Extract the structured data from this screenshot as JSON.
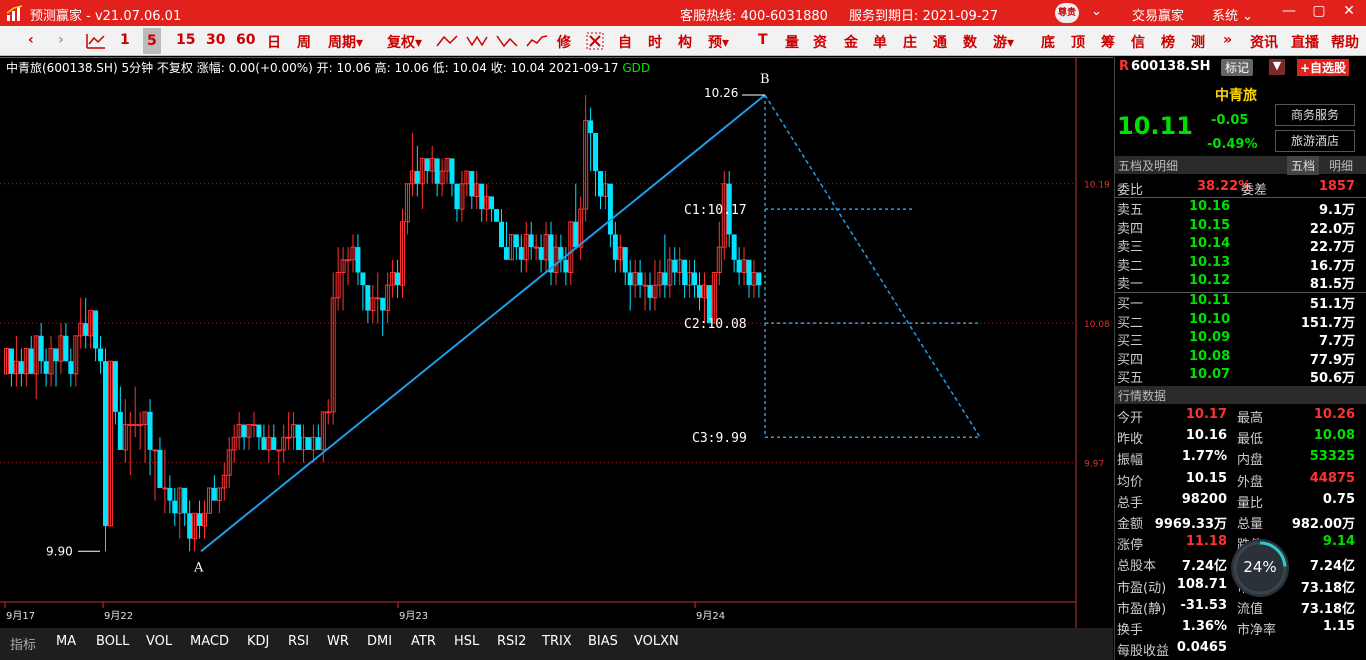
{
  "titlebar": {
    "app_title": "预测赢家 - v21.07.06.01",
    "hotline": "客服热线: 400-6031880",
    "expiry": "服务到期日: 2021-09-27",
    "avatar_text": "尊贵",
    "menu_trade": "交易赢家",
    "menu_system": "系统",
    "minimize": "—",
    "restore": "▢",
    "close": "✕"
  },
  "toolbar": {
    "periods": [
      "1",
      "5",
      "15",
      "30",
      "60",
      "日",
      "周"
    ],
    "selected_period": "5",
    "period_menu": "周期",
    "fq": "复权",
    "xiu": "修",
    "items": [
      "自",
      "时",
      "构",
      "预"
    ],
    "items2": [
      "T",
      "量",
      "资",
      "金",
      "单",
      "庄",
      "通",
      "数",
      "游"
    ],
    "items3": [
      "底",
      "顶",
      "筹",
      "信",
      "榜",
      "测"
    ],
    "more": "»",
    "news": "资讯",
    "live": "直播",
    "help": "帮助"
  },
  "chart": {
    "info": "中青旅(600138.SH) 5分钟 不复权 涨幅: 0.00(+0.00%) 开: 10.06 高: 10.06 低: 10.04 收: 10.04 2021-09-17",
    "indicator_name": "GDD",
    "annotations": {
      "b_price": "10.26",
      "b_label": "B",
      "a_price": "9.90",
      "a_label": "A",
      "c1": "C1:10.17",
      "c2": "C2:10.08",
      "c3": "C3:9.99"
    },
    "right_axis": [
      "10.19",
      "10.08",
      "9.97"
    ],
    "x_labels": [
      "9月17",
      "9月22",
      "9月23",
      "9月24"
    ]
  },
  "chart_data": {
    "type": "candlestick",
    "ylim": [
      9.86,
      10.29
    ],
    "right_axis_ticks": [
      10.19,
      10.08,
      9.97
    ],
    "pattern": {
      "A": 9.9,
      "B": 10.26,
      "C1": 10.17,
      "C2": 10.08,
      "C3": 9.99
    },
    "candles": [
      [
        10.04,
        10.06,
        10.04,
        10.06
      ],
      [
        10.06,
        10.04,
        10.03,
        10.06
      ],
      [
        10.04,
        10.05,
        10.03,
        10.07
      ],
      [
        10.05,
        10.04,
        10.03,
        10.06
      ],
      [
        10.04,
        10.06,
        10.03,
        10.06
      ],
      [
        10.06,
        10.04,
        10.04,
        10.07
      ],
      [
        10.04,
        10.07,
        10.02,
        10.07
      ],
      [
        10.07,
        10.05,
        10.04,
        10.08
      ],
      [
        10.05,
        10.04,
        10.03,
        10.06
      ],
      [
        10.04,
        10.06,
        10.03,
        10.07
      ],
      [
        10.06,
        10.05,
        10.03,
        10.06
      ],
      [
        10.05,
        10.07,
        10.04,
        10.08
      ],
      [
        10.07,
        10.05,
        10.05,
        10.08
      ],
      [
        10.05,
        10.04,
        10.03,
        10.06
      ],
      [
        10.04,
        10.07,
        10.03,
        10.07
      ],
      [
        10.07,
        10.08,
        10.06,
        10.1
      ],
      [
        10.08,
        10.07,
        10.06,
        10.1
      ],
      [
        10.07,
        10.09,
        10.06,
        10.09
      ],
      [
        10.09,
        10.06,
        10.05,
        10.09
      ],
      [
        10.06,
        10.05,
        10.04,
        10.07
      ],
      [
        10.05,
        9.92,
        9.9,
        10.06
      ],
      [
        9.92,
        10.05,
        9.92,
        10.05
      ],
      [
        10.05,
        10.01,
        10.0,
        10.05
      ],
      [
        10.01,
        9.98,
        9.98,
        10.03
      ],
      [
        9.98,
        10.0,
        9.97,
        10.02
      ],
      [
        10.0,
        10.0,
        9.96,
        10.01
      ],
      [
        10.0,
        10.0,
        9.99,
        10.03
      ],
      [
        10.0,
        10.0,
        9.98,
        10.01
      ],
      [
        10.0,
        10.01,
        9.97,
        10.01
      ],
      [
        10.01,
        9.98,
        9.96,
        10.02
      ],
      [
        9.98,
        9.98,
        9.94,
        9.98
      ],
      [
        9.98,
        9.95,
        9.95,
        9.99
      ],
      [
        9.95,
        9.95,
        9.93,
        9.98
      ],
      [
        9.95,
        9.94,
        9.93,
        9.96
      ],
      [
        9.94,
        9.93,
        9.92,
        9.95
      ],
      [
        9.93,
        9.95,
        9.91,
        9.95
      ],
      [
        9.95,
        9.93,
        9.92,
        9.95
      ],
      [
        9.93,
        9.91,
        9.9,
        9.94
      ],
      [
        9.91,
        9.93,
        9.9,
        9.93
      ],
      [
        9.93,
        9.92,
        9.91,
        9.94
      ],
      [
        9.92,
        9.93,
        9.91,
        9.94
      ],
      [
        9.93,
        9.95,
        9.93,
        9.95
      ],
      [
        9.95,
        9.94,
        9.94,
        9.96
      ],
      [
        9.94,
        9.95,
        9.93,
        9.95
      ],
      [
        9.95,
        9.96,
        9.94,
        9.97
      ],
      [
        9.96,
        9.98,
        9.95,
        9.99
      ],
      [
        9.98,
        9.99,
        9.97,
        10.0
      ],
      [
        9.99,
        10.0,
        9.98,
        10.01
      ],
      [
        10.0,
        9.99,
        9.98,
        10.0
      ],
      [
        9.99,
        10.0,
        9.98,
        10.0
      ],
      [
        10.0,
        10.0,
        9.99,
        10.01
      ],
      [
        10.0,
        9.99,
        9.98,
        10.0
      ],
      [
        9.99,
        9.98,
        9.98,
        10.0
      ],
      [
        9.98,
        9.99,
        9.97,
        10.0
      ],
      [
        9.99,
        9.98,
        9.98,
        10.0
      ],
      [
        9.98,
        9.98,
        9.96,
        9.98
      ],
      [
        9.98,
        9.99,
        9.97,
        10.0
      ],
      [
        9.99,
        9.99,
        9.98,
        10.01
      ],
      [
        9.99,
        10.0,
        9.98,
        10.01
      ],
      [
        10.0,
        9.98,
        9.98,
        10.0
      ],
      [
        9.98,
        9.99,
        9.97,
        10.0
      ],
      [
        9.99,
        9.98,
        9.98,
        9.99
      ],
      [
        9.98,
        9.99,
        9.97,
        10.0
      ],
      [
        9.99,
        9.98,
        9.98,
        10.0
      ],
      [
        9.98,
        10.01,
        9.97,
        10.01
      ],
      [
        10.01,
        10.01,
        10.0,
        10.02
      ],
      [
        10.01,
        10.1,
        10.0,
        10.12
      ],
      [
        10.1,
        10.12,
        10.09,
        10.14
      ],
      [
        10.12,
        10.13,
        10.09,
        10.14
      ],
      [
        10.13,
        10.13,
        10.11,
        10.14
      ],
      [
        10.13,
        10.14,
        10.12,
        10.15
      ],
      [
        10.14,
        10.12,
        10.11,
        10.15
      ],
      [
        10.12,
        10.11,
        10.09,
        10.12
      ],
      [
        10.11,
        10.09,
        10.08,
        10.11
      ],
      [
        10.09,
        10.1,
        10.08,
        10.11
      ],
      [
        10.1,
        10.1,
        10.08,
        10.12
      ],
      [
        10.1,
        10.09,
        10.07,
        10.1
      ],
      [
        10.09,
        10.11,
        10.08,
        10.12
      ],
      [
        10.11,
        10.12,
        10.1,
        10.13
      ],
      [
        10.12,
        10.11,
        10.1,
        10.13
      ],
      [
        10.11,
        10.16,
        10.1,
        10.17
      ],
      [
        10.16,
        10.19,
        10.15,
        10.19
      ],
      [
        10.19,
        10.2,
        10.18,
        10.23
      ],
      [
        10.2,
        10.19,
        10.18,
        10.22
      ],
      [
        10.19,
        10.21,
        10.17,
        10.21
      ],
      [
        10.21,
        10.2,
        10.19,
        10.21
      ],
      [
        10.2,
        10.21,
        10.19,
        10.22
      ],
      [
        10.21,
        10.19,
        10.18,
        10.21
      ],
      [
        10.19,
        10.2,
        10.18,
        10.21
      ],
      [
        10.2,
        10.21,
        10.19,
        10.21
      ],
      [
        10.21,
        10.19,
        10.18,
        10.21
      ],
      [
        10.19,
        10.17,
        10.16,
        10.19
      ],
      [
        10.17,
        10.19,
        10.16,
        10.2
      ],
      [
        10.19,
        10.2,
        10.18,
        10.2
      ],
      [
        10.2,
        10.18,
        10.17,
        10.2
      ],
      [
        10.18,
        10.19,
        10.17,
        10.2
      ],
      [
        10.19,
        10.17,
        10.16,
        10.19
      ],
      [
        10.17,
        10.18,
        10.16,
        10.19
      ],
      [
        10.18,
        10.17,
        10.16,
        10.18
      ],
      [
        10.17,
        10.16,
        10.16,
        10.17
      ],
      [
        10.16,
        10.14,
        10.14,
        10.17
      ],
      [
        10.14,
        10.13,
        10.13,
        10.16
      ],
      [
        10.13,
        10.15,
        10.13,
        10.15
      ],
      [
        10.15,
        10.14,
        10.13,
        10.15
      ],
      [
        10.14,
        10.13,
        10.12,
        10.15
      ],
      [
        10.13,
        10.15,
        10.12,
        10.16
      ],
      [
        10.15,
        10.14,
        10.13,
        10.16
      ],
      [
        10.14,
        10.14,
        10.13,
        10.15
      ],
      [
        10.14,
        10.13,
        10.12,
        10.15
      ],
      [
        10.13,
        10.15,
        10.12,
        10.16
      ],
      [
        10.15,
        10.12,
        10.11,
        10.16
      ],
      [
        10.12,
        10.14,
        10.11,
        10.15
      ],
      [
        10.14,
        10.13,
        10.12,
        10.15
      ],
      [
        10.13,
        10.12,
        10.11,
        10.14
      ],
      [
        10.12,
        10.16,
        10.11,
        10.16
      ],
      [
        10.16,
        10.14,
        10.14,
        10.19
      ],
      [
        10.14,
        10.17,
        10.13,
        10.18
      ],
      [
        10.17,
        10.24,
        10.16,
        10.26
      ],
      [
        10.24,
        10.23,
        10.2,
        10.25
      ],
      [
        10.23,
        10.2,
        10.18,
        10.23
      ],
      [
        10.2,
        10.18,
        10.17,
        10.2
      ],
      [
        10.18,
        10.19,
        10.17,
        10.2
      ],
      [
        10.19,
        10.15,
        10.14,
        10.19
      ],
      [
        10.15,
        10.13,
        10.12,
        10.16
      ],
      [
        10.13,
        10.14,
        10.12,
        10.15
      ],
      [
        10.14,
        10.12,
        10.11,
        10.14
      ],
      [
        10.12,
        10.11,
        10.09,
        10.13
      ],
      [
        10.11,
        10.12,
        10.1,
        10.13
      ],
      [
        10.12,
        10.11,
        10.1,
        10.13
      ],
      [
        10.11,
        10.11,
        10.09,
        10.12
      ],
      [
        10.11,
        10.1,
        10.09,
        10.12
      ],
      [
        10.1,
        10.11,
        10.09,
        10.13
      ],
      [
        10.11,
        10.12,
        10.1,
        10.13
      ],
      [
        10.12,
        10.11,
        10.1,
        10.15
      ],
      [
        10.11,
        10.13,
        10.1,
        10.14
      ],
      [
        10.13,
        10.12,
        10.11,
        10.14
      ],
      [
        10.12,
        10.13,
        10.11,
        10.14
      ],
      [
        10.13,
        10.11,
        10.1,
        10.13
      ],
      [
        10.11,
        10.12,
        10.1,
        10.13
      ],
      [
        10.12,
        10.11,
        10.1,
        10.13
      ],
      [
        10.11,
        10.1,
        10.09,
        10.12
      ],
      [
        10.1,
        10.11,
        10.08,
        10.12
      ],
      [
        10.11,
        10.08,
        10.08,
        10.11
      ],
      [
        10.08,
        10.12,
        10.08,
        10.12
      ],
      [
        10.12,
        10.14,
        10.11,
        10.16
      ],
      [
        10.14,
        10.19,
        10.13,
        10.2
      ],
      [
        10.19,
        10.15,
        10.14,
        10.2
      ],
      [
        10.15,
        10.13,
        10.12,
        10.15
      ],
      [
        10.13,
        10.12,
        10.11,
        10.14
      ],
      [
        10.12,
        10.13,
        10.11,
        10.14
      ],
      [
        10.13,
        10.11,
        10.1,
        10.13
      ],
      [
        10.11,
        10.12,
        10.1,
        10.13
      ],
      [
        10.12,
        10.11,
        10.1,
        10.12
      ]
    ]
  },
  "indicators": {
    "label": "指标",
    "items": [
      "MA",
      "BOLL",
      "VOL",
      "MACD",
      "KDJ",
      "RSI",
      "WR",
      "DMI",
      "ATR",
      "HSL",
      "RSI2",
      "TRIX",
      "BIAS",
      "VOLXN"
    ]
  },
  "sidebar": {
    "code": "600138.SH",
    "code_prefix": "R",
    "mark_btn": "标记",
    "self_btn": "+自选股",
    "name": "中青旅",
    "price": "10.11",
    "change": "-0.05",
    "change_pct": "-0.49%",
    "tag1": "商务服务",
    "tag2": "旅游酒店",
    "tab_title": "五档及明细",
    "tab_five": "五档",
    "tab_detail": "明细",
    "weibi_label": "委比",
    "weibi": "38.22%",
    "weicha_label": "委差",
    "weicha": "1857",
    "asks": [
      {
        "label": "卖五",
        "price": "10.16",
        "vol": "9.1万"
      },
      {
        "label": "卖四",
        "price": "10.15",
        "vol": "22.0万"
      },
      {
        "label": "卖三",
        "price": "10.14",
        "vol": "22.7万"
      },
      {
        "label": "卖二",
        "price": "10.13",
        "vol": "16.7万"
      },
      {
        "label": "卖一",
        "price": "10.12",
        "vol": "81.5万"
      }
    ],
    "bids": [
      {
        "label": "买一",
        "price": "10.11",
        "vol": "51.1万"
      },
      {
        "label": "买二",
        "price": "10.10",
        "vol": "151.7万"
      },
      {
        "label": "买三",
        "price": "10.09",
        "vol": "7.7万"
      },
      {
        "label": "买四",
        "price": "10.08",
        "vol": "77.9万"
      },
      {
        "label": "买五",
        "price": "10.07",
        "vol": "50.6万"
      }
    ],
    "stats_title": "行情数据",
    "stats": [
      {
        "l1": "今开",
        "v1": "10.17",
        "c1": "red",
        "l2": "最高",
        "v2": "10.26",
        "c2": "red"
      },
      {
        "l1": "昨收",
        "v1": "10.16",
        "c1": "wht",
        "l2": "最低",
        "v2": "10.08",
        "c2": "grn"
      },
      {
        "l1": "振幅",
        "v1": "1.77%",
        "c1": "wht",
        "l2": "内盘",
        "v2": "53325",
        "c2": "grn"
      },
      {
        "l1": "均价",
        "v1": "10.15",
        "c1": "wht",
        "l2": "外盘",
        "v2": "44875",
        "c2": "red"
      },
      {
        "l1": "总手",
        "v1": "98200",
        "c1": "wht",
        "l2": "量比",
        "v2": "0.75",
        "c2": "wht"
      },
      {
        "l1": "金额",
        "v1": "9969.33万",
        "c1": "wht",
        "l2": "总量",
        "v2": "982.00万",
        "c2": "wht"
      },
      {
        "l1": "涨停",
        "v1": "11.18",
        "c1": "red",
        "l2": "跌停",
        "v2": "9.14",
        "c2": "grn"
      },
      {
        "l1": "总股本",
        "v1": "7.24亿",
        "c1": "wht",
        "l2": "流通",
        "v2": "7.24亿",
        "c2": "wht"
      },
      {
        "l1": "市盈(动)",
        "v1": "108.71",
        "c1": "wht",
        "l2": "市值",
        "v2": "73.18亿",
        "c2": "wht"
      },
      {
        "l1": "市盈(静)",
        "v1": "-31.53",
        "c1": "wht",
        "l2": "流值",
        "v2": "73.18亿",
        "c2": "wht"
      },
      {
        "l1": "换手",
        "v1": "1.36%",
        "c1": "wht",
        "l2": "市净率",
        "v2": "1.15",
        "c2": "wht"
      },
      {
        "l1": "每股收益",
        "v1": "0.0465",
        "c1": "wht",
        "l2": "",
        "v2": "",
        "c2": "wht"
      }
    ],
    "progress_text": "24%",
    "progress_value": 0.24
  },
  "colors": {
    "up": "#ff3232",
    "down": "#00e5ff",
    "line": "#1e9ee6",
    "title_bg": "#e2211c"
  }
}
